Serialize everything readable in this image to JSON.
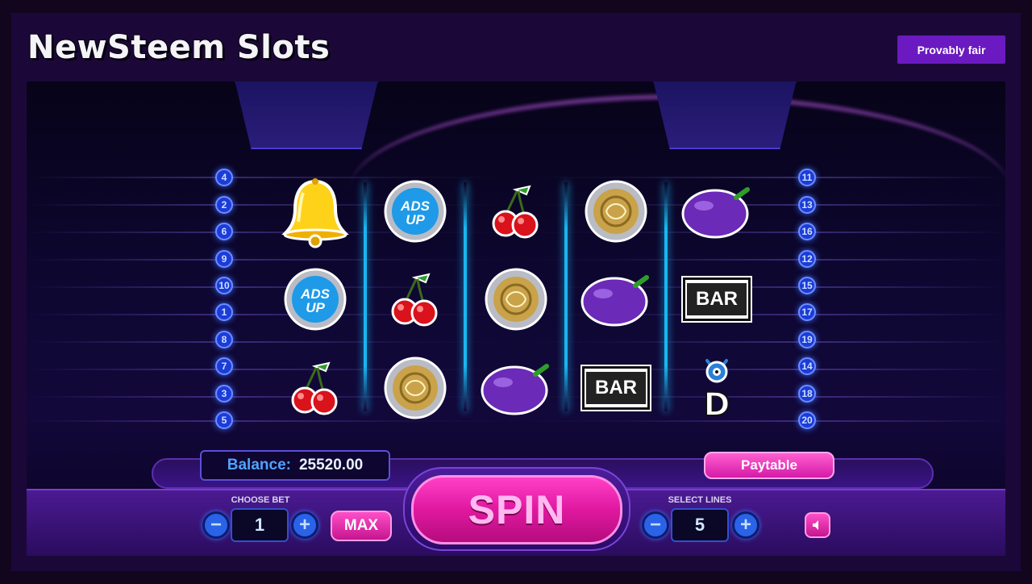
{
  "header": {
    "title": "NewSteem Slots",
    "provably_fair_label": "Provably fair"
  },
  "paylines": {
    "left": [
      "4",
      "2",
      "6",
      "9",
      "10",
      "1",
      "8",
      "7",
      "3",
      "5"
    ],
    "right": [
      "11",
      "13",
      "16",
      "12",
      "15",
      "17",
      "19",
      "14",
      "18",
      "20"
    ]
  },
  "reels": [
    [
      "bell-icon",
      "ads-up-coin-icon",
      "cherry-icon"
    ],
    [
      "ads-up-coin-icon",
      "cherry-icon",
      "silver-gold-coin-icon"
    ],
    [
      "cherry-icon",
      "silver-gold-coin-icon",
      "plum-icon"
    ],
    [
      "silver-gold-coin-icon",
      "plum-icon",
      "bar-icon"
    ],
    [
      "plum-icon",
      "bar-icon",
      "monster-d-icon"
    ]
  ],
  "symbols": {
    "ads_up_text_1": "ADS",
    "ads_up_text_2": "UP",
    "bar_text": "BAR",
    "d_text": "D"
  },
  "balance": {
    "label": "Balance:",
    "value": "25520.00"
  },
  "paytable_label": "Paytable",
  "bet": {
    "label": "CHOOSE BET",
    "value": "1",
    "minus": "−",
    "plus": "+",
    "max_label": "MAX"
  },
  "spin_label": "SPIN",
  "lines": {
    "label": "SELECT LINES",
    "value": "5",
    "minus": "−",
    "plus": "+"
  },
  "colors": {
    "accent_pink": "#e0189f",
    "accent_blue": "#2a62e8",
    "provably_purple": "#6a1ac0",
    "reel_divider": "#19b6f0"
  }
}
